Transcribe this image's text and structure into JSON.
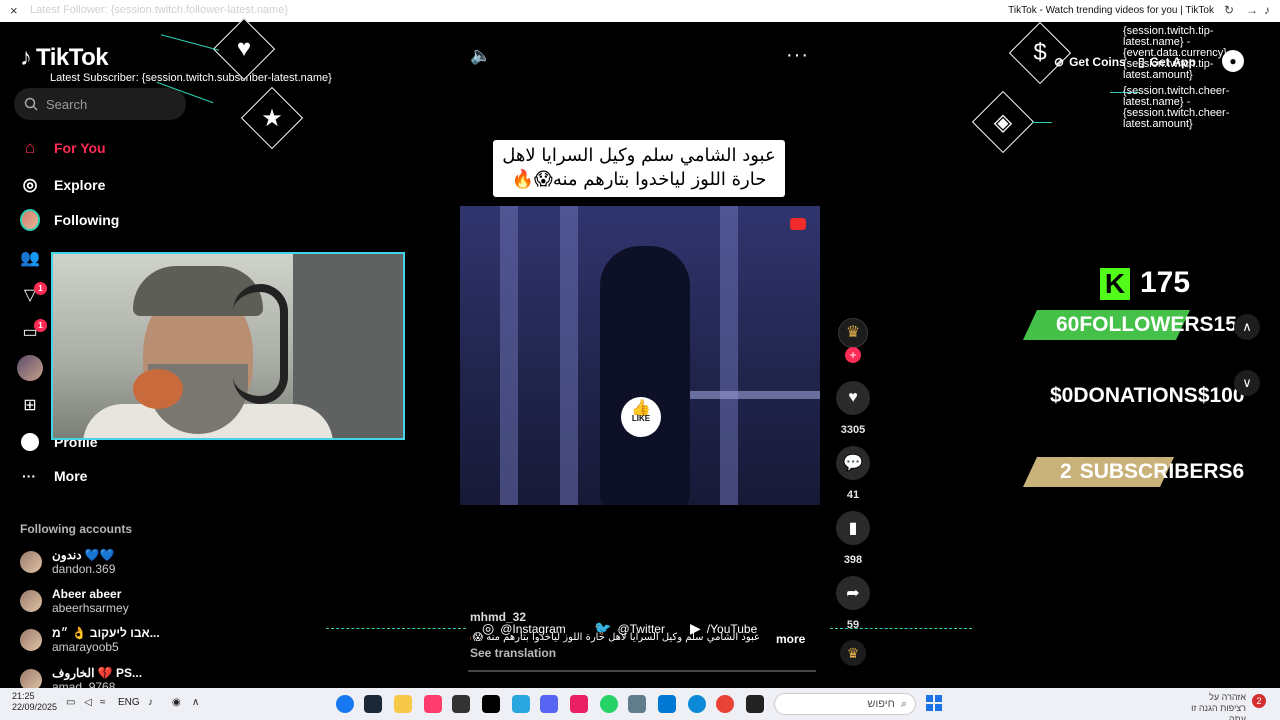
{
  "browser": {
    "close_icon": "×",
    "ghost_url": "Latest Follower: {session.twitch.follower-latest.name}",
    "window_title": "TikTok - Watch trending videos for you | TikTok"
  },
  "sidebar": {
    "logo": "TikTok",
    "search_placeholder": "Search",
    "nav": [
      {
        "label": "For You",
        "active": true
      },
      {
        "label": "Explore"
      },
      {
        "label": "Following"
      }
    ],
    "badges": {
      "activity": "1",
      "messages": "1"
    },
    "profile_label": "Profile",
    "more_label": "More",
    "following_title": "Following accounts",
    "accounts": [
      {
        "name": "دندون 💙💙",
        "handle": "dandon.369"
      },
      {
        "name": "Abeer abeer",
        "handle": "abeerhsarmey"
      },
      {
        "name": "אבו ליעקוב 👌 ״מ...",
        "handle": "amarayoob5"
      },
      {
        "name": "الخاروف 💔 PS...",
        "handle": "amad_9768"
      }
    ]
  },
  "overlay": {
    "latest_subscriber": "Latest Subscriber: {session.twitch.subscriber-latest.name}",
    "tip_text": "{session.twitch.tip-latest.name} - {event.data.currency}{session.twitch.tip-latest.amount}",
    "cheer_text": "{session.twitch.cheer-latest.name} - {session.twitch.cheer-latest.amount}",
    "kick_count": "175",
    "goals": [
      {
        "left": "60",
        "label": "FOLLOWERS",
        "right": "150",
        "color": "#45c14a",
        "fill": 0.4
      },
      {
        "left": "$0",
        "label": "DONATIONS",
        "right": "$100",
        "color": "#45c14a",
        "fill": 0.0
      },
      {
        "left": "2",
        "label": "SUBSCRIBERS",
        "right": "6",
        "color": "#c9b27a",
        "fill": 0.33
      }
    ],
    "social": [
      {
        "icon": "instagram-icon",
        "glyph": "◎",
        "label": "@Instagram"
      },
      {
        "icon": "twitter-icon",
        "glyph": "🐦",
        "label": "@Twitter"
      },
      {
        "icon": "youtube-icon",
        "glyph": "▶",
        "label": "/YouTube"
      }
    ]
  },
  "video": {
    "caption": "عبود الشامي سلم وكيل السرايا لاهل حارة اللوز لياخدوا بتارهم منه😱🔥",
    "like_label": "LIKE",
    "likes": "3305",
    "comments": "41",
    "saves": "398",
    "shares": "59",
    "username": "mhmd_32",
    "description": "عبود الشامي سلم وكيل السرايا لاهل حارة اللوز لياخدوا بتارهم منه 😱🔥 ...",
    "more_label": "more",
    "see_translation": "See translation"
  },
  "header_right": {
    "get_coins": "Get Coins",
    "get_app": "Get App"
  },
  "taskbar": {
    "time": "21:25",
    "date": "22/09/2025",
    "lang": "ENG",
    "search_label": "חיפוש",
    "notice": "אזהרה על רציפות הגנה זו עתה"
  },
  "colors": {
    "accent": "#fe2c55",
    "overlay_line": "#2fd1b4",
    "kick_green": "#53fc18"
  }
}
